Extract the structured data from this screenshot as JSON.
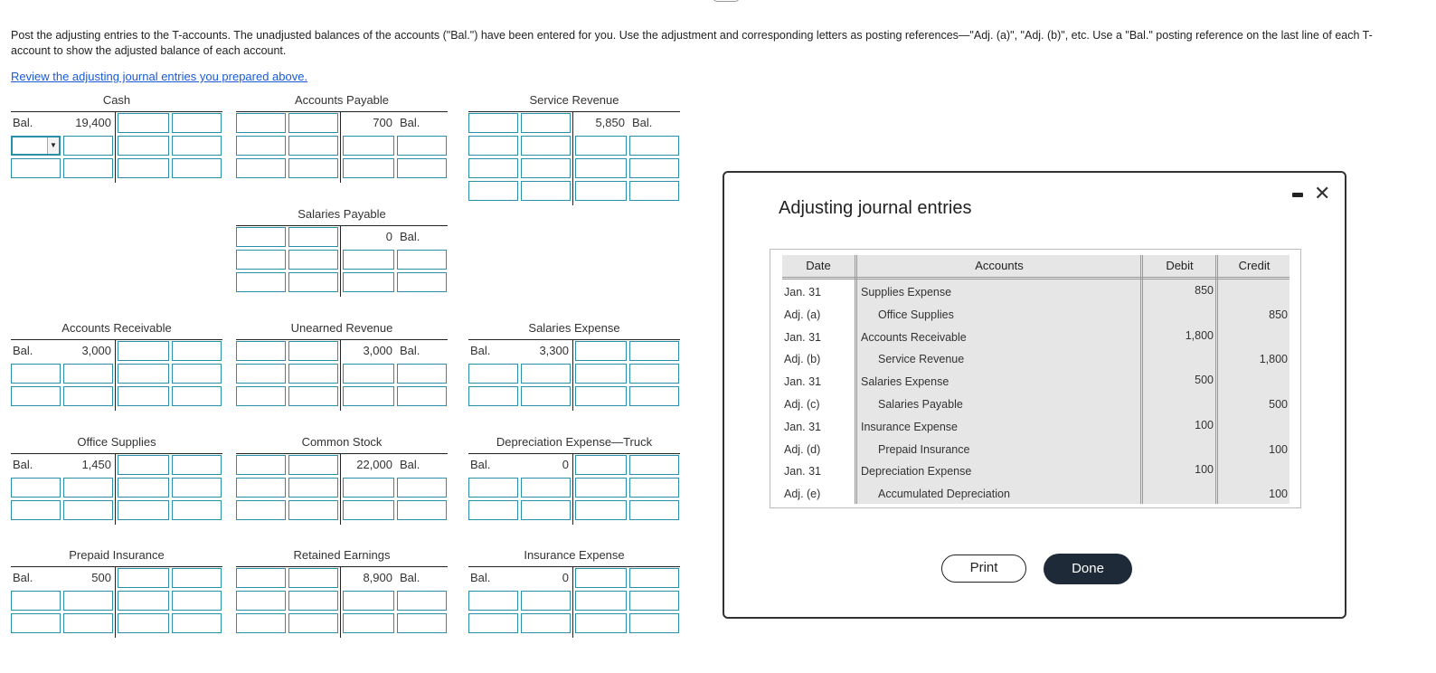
{
  "instructions": "Post the adjusting entries to the T-accounts. The unadjusted balances of the accounts (\"Bal.\") have been entered for you. Use the adjustment and corresponding letters as posting references—\"Adj. (a)\", \"Adj. (b)\", etc. Use a \"Bal.\" posting reference on the last line of each T-account to show the adjusted balance of each account.",
  "review_link": "Review the adjusting journal entries you prepared above.",
  "accounts": [
    {
      "name": "Cash",
      "bal_label_left": "Bal.",
      "bal_debit": "19,400",
      "bal_credit": "",
      "bal_label_right": ""
    },
    {
      "name": "Accounts Payable",
      "bal_label_left": "",
      "bal_debit": "",
      "bal_credit": "700",
      "bal_label_right": "Bal."
    },
    {
      "name": "Service Revenue",
      "bal_label_left": "",
      "bal_debit": "",
      "bal_credit": "5,850",
      "bal_label_right": "Bal."
    },
    {
      "name": "Salaries Payable",
      "bal_label_left": "",
      "bal_debit": "",
      "bal_credit": "0",
      "bal_label_right": "Bal."
    },
    {
      "name": "Accounts Receivable",
      "bal_label_left": "Bal.",
      "bal_debit": "3,000",
      "bal_credit": "",
      "bal_label_right": ""
    },
    {
      "name": "Unearned Revenue",
      "bal_label_left": "",
      "bal_debit": "",
      "bal_credit": "3,000",
      "bal_label_right": "Bal."
    },
    {
      "name": "Salaries Expense",
      "bal_label_left": "Bal.",
      "bal_debit": "3,300",
      "bal_credit": "",
      "bal_label_right": ""
    },
    {
      "name": "Office Supplies",
      "bal_label_left": "Bal.",
      "bal_debit": "1,450",
      "bal_credit": "",
      "bal_label_right": ""
    },
    {
      "name": "Common Stock",
      "bal_label_left": "",
      "bal_debit": "",
      "bal_credit": "22,000",
      "bal_label_right": "Bal."
    },
    {
      "name": "Depreciation Expense—Truck",
      "bal_label_left": "Bal.",
      "bal_debit": "0",
      "bal_credit": "",
      "bal_label_right": ""
    },
    {
      "name": "Prepaid Insurance",
      "bal_label_left": "Bal.",
      "bal_debit": "500",
      "bal_credit": "",
      "bal_label_right": ""
    },
    {
      "name": "Retained Earnings",
      "bal_label_left": "",
      "bal_debit": "",
      "bal_credit": "8,900",
      "bal_label_right": "Bal."
    },
    {
      "name": "Insurance Expense",
      "bal_label_left": "Bal.",
      "bal_debit": "0",
      "bal_credit": "",
      "bal_label_right": ""
    }
  ],
  "modal": {
    "title": "Adjusting journal entries",
    "headers": {
      "date": "Date",
      "accounts": "Accounts",
      "debit": "Debit",
      "credit": "Credit"
    },
    "rows": [
      {
        "date": "Jan. 31",
        "account": "Supplies Expense",
        "debit": "850",
        "credit": ""
      },
      {
        "date": "Adj. (a)",
        "account": "Office Supplies",
        "debit": "",
        "credit": "850"
      },
      {
        "date": "Jan. 31",
        "account": "Accounts Receivable",
        "debit": "1,800",
        "credit": ""
      },
      {
        "date": "Adj. (b)",
        "account": "Service Revenue",
        "debit": "",
        "credit": "1,800"
      },
      {
        "date": "Jan. 31",
        "account": "Salaries Expense",
        "debit": "500",
        "credit": ""
      },
      {
        "date": "Adj. (c)",
        "account": "Salaries Payable",
        "debit": "",
        "credit": "500"
      },
      {
        "date": "Jan. 31",
        "account": "Insurance Expense",
        "debit": "100",
        "credit": ""
      },
      {
        "date": "Adj. (d)",
        "account": "Prepaid Insurance",
        "debit": "",
        "credit": "100"
      },
      {
        "date": "Jan. 31",
        "account": "Depreciation Expense",
        "debit": "100",
        "credit": ""
      },
      {
        "date": "Adj. (e)",
        "account": "Accumulated Depreciation",
        "debit": "",
        "credit": "100"
      }
    ],
    "print_label": "Print",
    "done_label": "Done",
    "close_icon": "✕"
  },
  "dropdown_arrow": "▼"
}
